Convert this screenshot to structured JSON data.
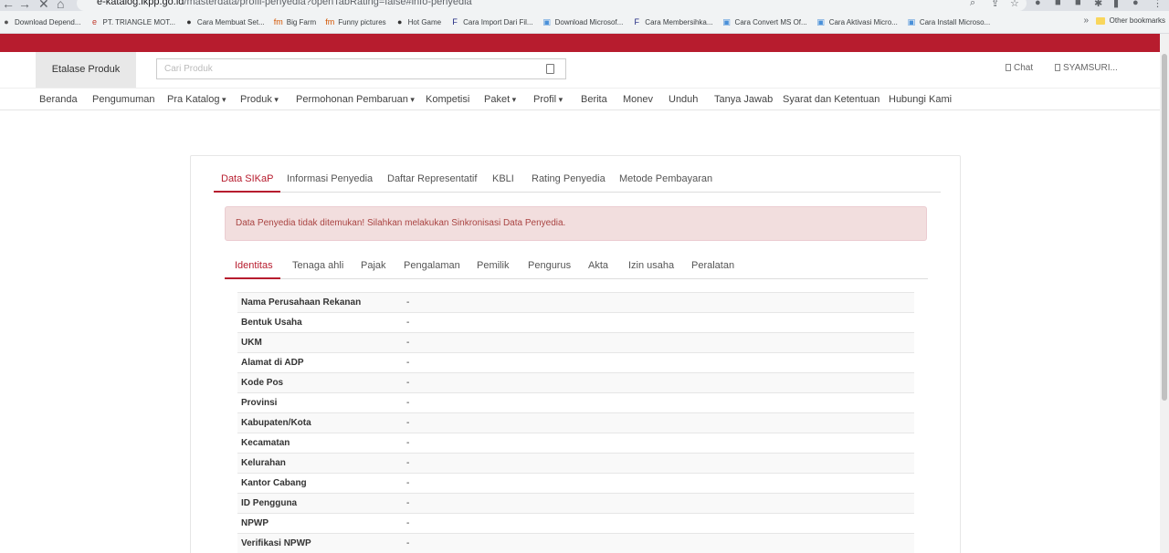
{
  "browser": {
    "url_host": "e-katalog.lkpp.go.id",
    "url_path": "/masterdata/profil-penyedia?openTabRating=false#info-penyedia",
    "bookmarks": [
      {
        "label": "Download Depend...",
        "icon": "globe-icon",
        "color": "#555555"
      },
      {
        "label": "PT. TRIANGLE MOT...",
        "icon": "e-logo-icon",
        "color": "#c0392b"
      },
      {
        "label": "Cara Membuat Set...",
        "icon": "globe-icon",
        "color": "#333333"
      },
      {
        "label": "Big Farm",
        "icon": "fm-logo-icon",
        "color": "#d35400"
      },
      {
        "label": "Funny pictures",
        "icon": "fm-logo-icon",
        "color": "#d35400"
      },
      {
        "label": "Hot Game",
        "icon": "globe-icon",
        "color": "#333333"
      },
      {
        "label": "Cara Import Dari Fil...",
        "icon": "f-logo-icon",
        "color": "#1a237e"
      },
      {
        "label": "Download Microsof...",
        "icon": "site-icon",
        "color": "#4a90d9"
      },
      {
        "label": "Cara Membersihka...",
        "icon": "f-logo-icon",
        "color": "#1a237e"
      },
      {
        "label": "Cara Convert MS Of...",
        "icon": "site-icon",
        "color": "#4a90d9"
      },
      {
        "label": "Cara Aktivasi Micro...",
        "icon": "site-icon",
        "color": "#4a90d9"
      },
      {
        "label": "Cara Install Microso...",
        "icon": "site-icon",
        "color": "#4a90d9"
      }
    ],
    "more_bookmarks": "»",
    "other_bookmarks": "Other bookmarks"
  },
  "header": {
    "etalase_label": "Etalase Produk",
    "search_placeholder": "Cari Produk",
    "chat_label": "Chat",
    "user_label": "SYAMSURI..."
  },
  "nav": [
    {
      "label": "Beranda",
      "dropdown": false
    },
    {
      "label": "Pengumuman",
      "dropdown": false
    },
    {
      "label": "Pra Katalog",
      "dropdown": true
    },
    {
      "label": "Produk",
      "dropdown": true
    },
    {
      "label": "Permohonan Pembaruan",
      "dropdown": true
    },
    {
      "label": "Kompetisi",
      "dropdown": false
    },
    {
      "label": "Paket",
      "dropdown": true
    },
    {
      "label": "Profil",
      "dropdown": true
    },
    {
      "label": "Berita",
      "dropdown": false
    },
    {
      "label": "Monev",
      "dropdown": false
    },
    {
      "label": "Unduh",
      "dropdown": false
    },
    {
      "label": "Tanya Jawab",
      "dropdown": false
    },
    {
      "label": "Syarat dan Ketentuan",
      "dropdown": false
    },
    {
      "label": "Hubungi Kami",
      "dropdown": false
    }
  ],
  "tabs": [
    "Data SIKaP",
    "Informasi Penyedia",
    "Daftar Representatif",
    "KBLI",
    "Rating Penyedia",
    "Metode Pembayaran"
  ],
  "alert": "Data Penyedia tidak ditemukan! Silahkan melakukan Sinkronisasi Data Penyedia.",
  "subtabs": [
    "Identitas",
    "Tenaga ahli",
    "Pajak",
    "Pengalaman",
    "Pemilik",
    "Pengurus",
    "Akta",
    "Izin usaha",
    "Peralatan"
  ],
  "identitas_rows": [
    {
      "label": "Nama Perusahaan Rekanan",
      "value": "-"
    },
    {
      "label": "Bentuk Usaha",
      "value": "-"
    },
    {
      "label": "UKM",
      "value": "-"
    },
    {
      "label": "Alamat di ADP",
      "value": "-"
    },
    {
      "label": "Kode Pos",
      "value": "-"
    },
    {
      "label": "Provinsi",
      "value": "-"
    },
    {
      "label": "Kabupaten/Kota",
      "value": "-"
    },
    {
      "label": "Kecamatan",
      "value": "-"
    },
    {
      "label": "Kelurahan",
      "value": "-"
    },
    {
      "label": "Kantor Cabang",
      "value": "-"
    },
    {
      "label": "ID Pengguna",
      "value": "-"
    },
    {
      "label": "NPWP",
      "value": "-"
    },
    {
      "label": "Verifikasi NPWP",
      "value": "-"
    }
  ],
  "colors": {
    "brand_red": "#b71c2e",
    "alert_bg": "#f2dede",
    "alert_text": "#a94442"
  }
}
